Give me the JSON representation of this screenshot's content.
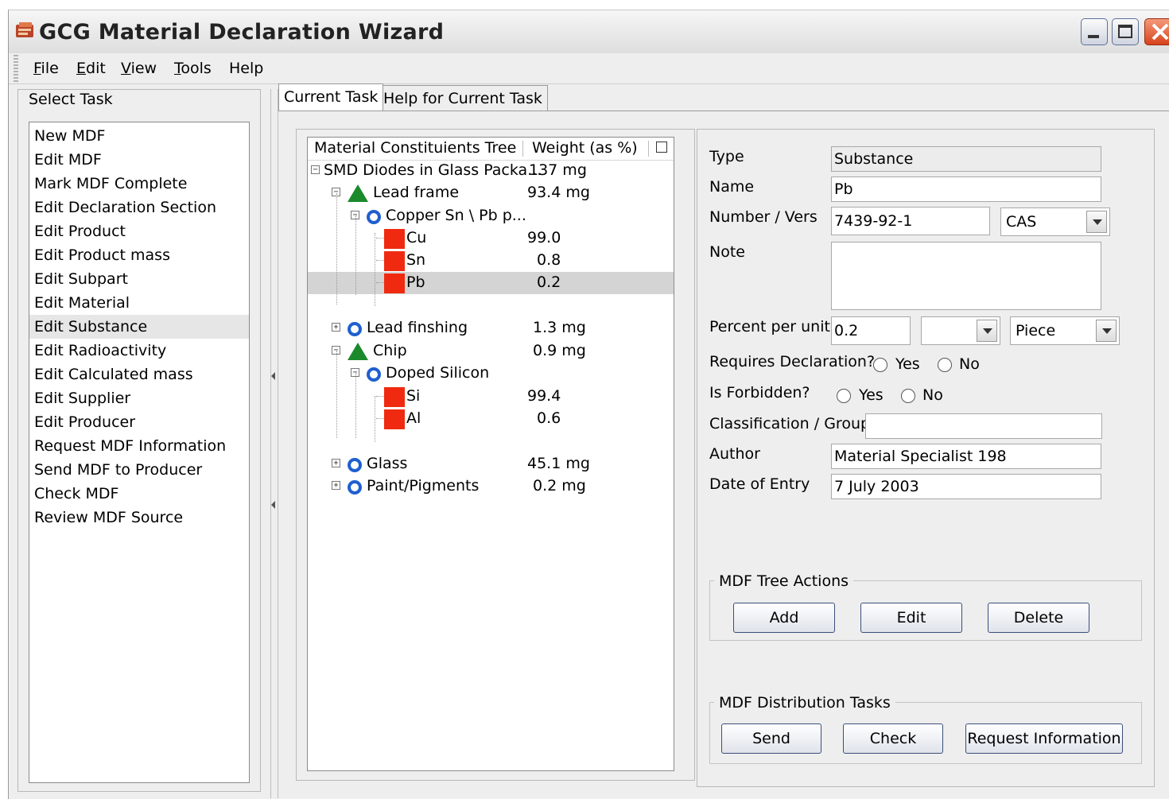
{
  "window": {
    "title": "GCG Material Declaration Wizard",
    "app_icon": "app-icon",
    "controls": [
      "minimize-icon",
      "maximize-icon",
      "close-icon"
    ]
  },
  "menubar": {
    "items": [
      {
        "label": "File",
        "accel": "F",
        "rest": "ile"
      },
      {
        "label": "Edit",
        "accel": "E",
        "rest": "dit"
      },
      {
        "label": "View",
        "accel": "V",
        "rest": "iew"
      },
      {
        "label": "Tools",
        "accel": "T",
        "rest": "ools"
      },
      {
        "label": "Help",
        "accel": "",
        "rest": "Help"
      }
    ]
  },
  "left_panel": {
    "title": "Select Task",
    "selected_index": 8,
    "tasks": [
      "New MDF",
      "Edit MDF",
      "Mark MDF Complete",
      "Edit Declaration Section",
      "Edit Product",
      "Edit Product mass",
      "Edit Subpart",
      "Edit Material",
      "Edit Substance",
      "Edit Radioactivity",
      "Edit Calculated mass",
      "Edit Supplier",
      "Edit Producer",
      "Request MDF Information",
      "Send MDF to Producer",
      "Check MDF",
      "Review MDF Source"
    ]
  },
  "tabs": [
    {
      "label": "Current Task",
      "active": true
    },
    {
      "label": "Help for Current Task",
      "active": false
    }
  ],
  "tree": {
    "col1": "Material Constituients Tree",
    "col2": "Weight (as %)",
    "rows": [
      {
        "label": "SMD Diodes in Glass Packa...",
        "weight": "137 mg",
        "level": 0,
        "icon": "none",
        "expander": "minus"
      },
      {
        "label": "Lead frame",
        "weight": "93.4 mg",
        "level": 1,
        "icon": "green-triangle-icon",
        "expander": "minus"
      },
      {
        "label": "Copper Sn \\ Pb p...",
        "weight": "",
        "level": 2,
        "icon": "blue-circle-icon",
        "expander": "minus"
      },
      {
        "label": "Cu",
        "weight": "99.0",
        "level": 3,
        "icon": "red-square-icon",
        "expander": "none"
      },
      {
        "label": "Sn",
        "weight": "0.8",
        "level": 3,
        "icon": "red-square-icon",
        "expander": "none"
      },
      {
        "label": "Pb",
        "weight": "0.2",
        "level": 3,
        "icon": "red-square-icon",
        "expander": "none",
        "selected": true
      },
      {
        "label": "Lead finshing",
        "weight": "1.3 mg",
        "level": 1,
        "icon": "blue-circle-icon",
        "expander": "plus"
      },
      {
        "label": "Chip",
        "weight": "0.9 mg",
        "level": 1,
        "icon": "green-triangle-icon",
        "expander": "minus"
      },
      {
        "label": "Doped Silicon",
        "weight": "",
        "level": 2,
        "icon": "blue-circle-icon",
        "expander": "minus"
      },
      {
        "label": "Si",
        "weight": "99.4",
        "level": 3,
        "icon": "red-square-icon",
        "expander": "none"
      },
      {
        "label": "Al",
        "weight": "0.6",
        "level": 3,
        "icon": "red-square-icon",
        "expander": "none"
      },
      {
        "label": "Glass",
        "weight": "45.1 mg",
        "level": 1,
        "icon": "blue-circle-icon",
        "expander": "plus"
      },
      {
        "label": "Paint/Pigments",
        "weight": "0.2 mg",
        "level": 1,
        "icon": "blue-circle-icon",
        "expander": "plus"
      }
    ]
  },
  "form": {
    "type_label": "Type",
    "type_value": "Substance",
    "name_label": "Name",
    "name_value": "Pb",
    "number_label": "Number / Vers",
    "number_value": "7439-92-1",
    "number_scheme": "CAS",
    "note_label": "Note",
    "note_value": "",
    "percent_label": "Percent per unit",
    "percent_value": "0.2",
    "percent_unit": "",
    "percent_per": "Piece",
    "requires_label": "Requires Declaration?",
    "forbidden_label": "Is Forbidden?",
    "yes_label": "Yes",
    "no_label": "No",
    "classification_label": "Classification / Group",
    "classification_value": "",
    "author_label": "Author",
    "author_value": "Material Specialist 198",
    "date_label": "Date of Entry",
    "date_value": "7 July 2003"
  },
  "tree_actions": {
    "legend": "MDF Tree Actions",
    "add": "Add",
    "edit": "Edit",
    "delete": "Delete"
  },
  "distribution": {
    "legend": "MDF Distribution Tasks",
    "send": "Send",
    "check": "Check",
    "request": "Request Information"
  }
}
